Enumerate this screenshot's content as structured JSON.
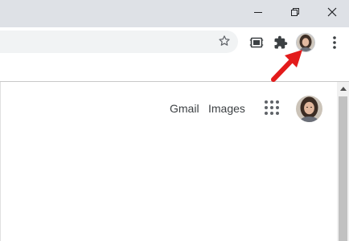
{
  "window_controls": {
    "minimize_icon": "minimize-icon",
    "restore_icon": "restore-icon",
    "close_icon": "close-icon"
  },
  "toolbar": {
    "bookmark_icon": "star-icon",
    "tab_search_icon": "tab-search-icon",
    "extensions_icon": "puzzle-icon",
    "profile_icon": "avatar",
    "menu_icon": "kebab-menu-icon"
  },
  "page": {
    "links": {
      "gmail": "Gmail",
      "images": "Images"
    },
    "apps_icon": "apps-grid-icon"
  },
  "annotation": {
    "arrow_color": "#e31b1b"
  },
  "colors": {
    "titlebar": "#dee1e6",
    "omnibox": "#f1f3f4",
    "icon": "#3c4043"
  }
}
